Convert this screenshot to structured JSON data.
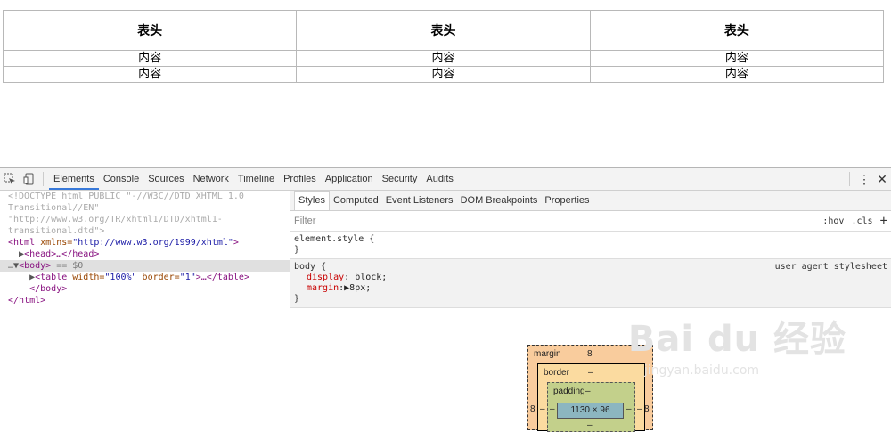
{
  "table": {
    "headers": [
      "表头",
      "表头",
      "表头"
    ],
    "rows": [
      [
        "内容",
        "内容",
        "内容"
      ],
      [
        "内容",
        "内容",
        "内容"
      ]
    ]
  },
  "devtools": {
    "tabs": [
      "Elements",
      "Console",
      "Sources",
      "Network",
      "Timeline",
      "Profiles",
      "Application",
      "Security",
      "Audits"
    ],
    "active_tab": "Elements",
    "icons": [
      "inspect-icon",
      "device-toggle-icon",
      "more-menu-icon",
      "close-icon"
    ],
    "more_glyph": "⋮",
    "close_glyph": "✕"
  },
  "elements_panel": {
    "doctype_l1": "<!DOCTYPE html PUBLIC \"-//W3C//DTD XHTML 1.0",
    "doctype_l2": "Transitional//EN\"",
    "doctype_l3": "\"http://www.w3.org/TR/xhtml1/DTD/xhtml1-",
    "doctype_l4": "transitional.dtd\">",
    "html_open": "<html",
    "html_attr": " xmlns=",
    "html_attr_val": "\"http://www.w3.org/1999/xhtml\"",
    "html_open_end": ">",
    "head_line": "<head>…</head>",
    "body_line": "<body>",
    "body_eq": " == $0",
    "table_open": "<table",
    "table_attr1": " width=",
    "table_attr1_val": "\"100%\"",
    "table_attr2": " border=",
    "table_attr2_val": "\"1\"",
    "table_rest": ">…</table>",
    "body_close": "</body>",
    "html_close": "</html>"
  },
  "styles_panel": {
    "tabs": [
      "Styles",
      "Computed",
      "Event Listeners",
      "DOM Breakpoints",
      "Properties"
    ],
    "filter_placeholder": "Filter",
    "hov": ":hov",
    "cls": ".cls",
    "plus": "+",
    "element_style_open": "element.style {",
    "close_brace": "}",
    "body_rule_open": "body {",
    "ua_label": "user agent stylesheet",
    "prop_display": "display",
    "val_display": "block;",
    "prop_margin": "margin",
    "val_margin": "▶8px;"
  },
  "box_model": {
    "margin_label": "margin",
    "margin_top": "8",
    "border_label": "border",
    "border_top": "–",
    "padding_label": "padding",
    "padding_top": "–",
    "content_size": "1130 × 96",
    "margin_left": "8",
    "margin_right": "8",
    "border_left": "–",
    "border_right": "–",
    "padding_left": "–",
    "padding_right": "–",
    "padding_bottom": "–"
  },
  "watermark": {
    "brand": "Bai du 经验",
    "url": "jingyan.baidu.com"
  }
}
